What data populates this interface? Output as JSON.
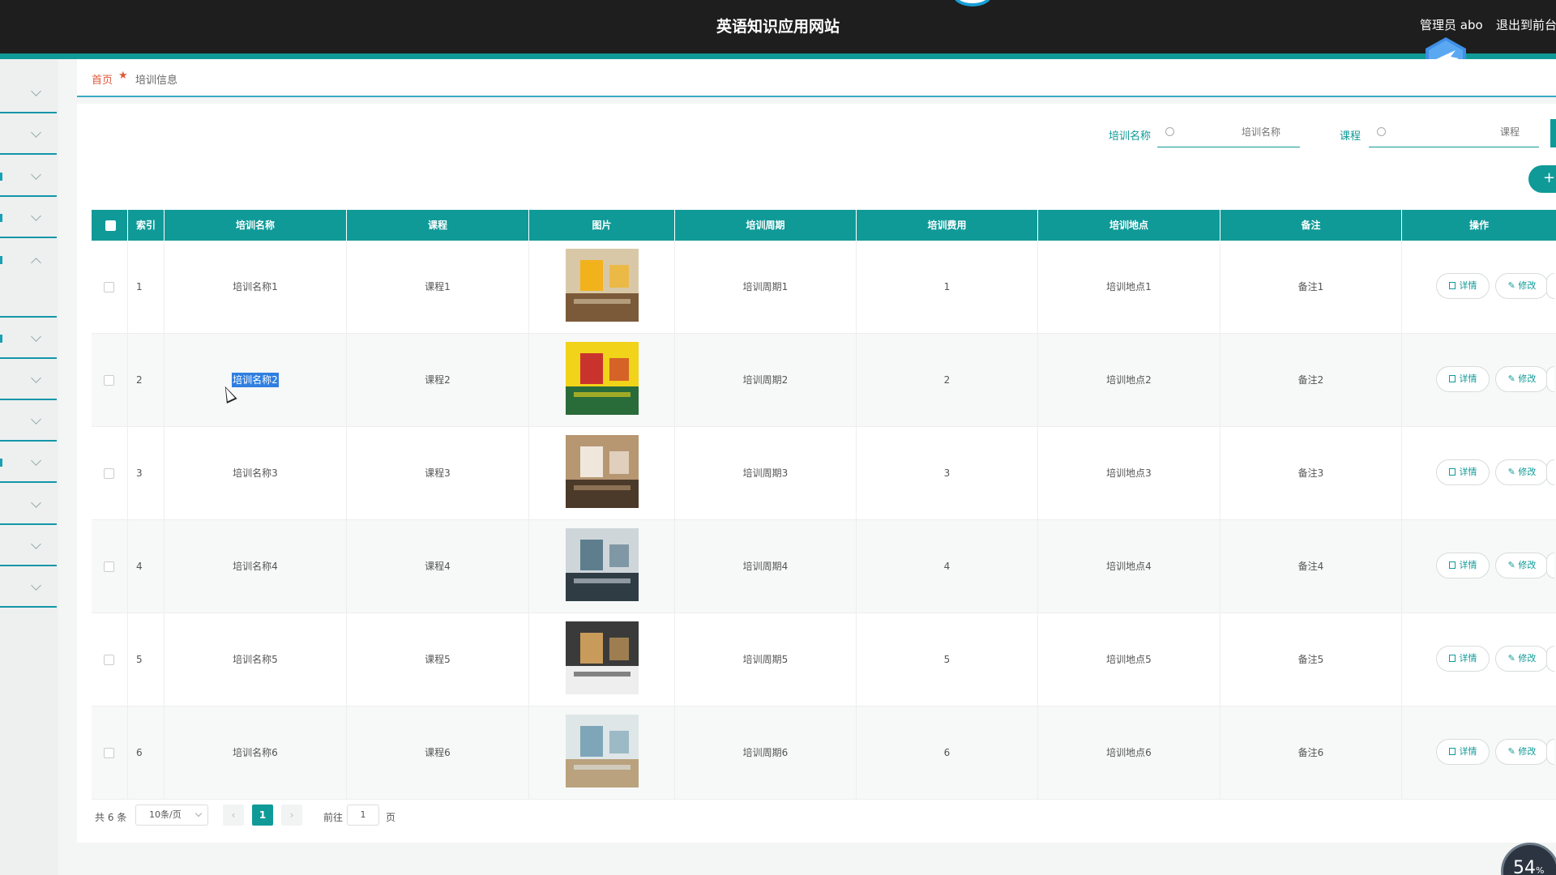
{
  "header": {
    "site_title": "英语知识应用网站",
    "user": "管理员 abo",
    "logout": "退出到前台"
  },
  "breadcrumb": {
    "home": "首页",
    "current": "培训信息"
  },
  "search": {
    "name_label": "培训名称",
    "name_placeholder": "培训名称",
    "course_label": "课程",
    "course_placeholder": "课程"
  },
  "toolbar": {
    "add_label": "+"
  },
  "table": {
    "columns": [
      "索引",
      "培训名称",
      "课程",
      "图片",
      "培训周期",
      "培训费用",
      "培训地点",
      "备注",
      "操作"
    ],
    "rows": [
      {
        "index": "1",
        "name": "培训名称1",
        "course": "课程1",
        "cycle": "培训周期1",
        "fee": "1",
        "location": "培训地点1",
        "note": "备注1"
      },
      {
        "index": "2",
        "name": "培训名称2",
        "course": "课程2",
        "cycle": "培训周期2",
        "fee": "2",
        "location": "培训地点2",
        "note": "备注2"
      },
      {
        "index": "3",
        "name": "培训名称3",
        "course": "课程3",
        "cycle": "培训周期3",
        "fee": "3",
        "location": "培训地点3",
        "note": "备注3"
      },
      {
        "index": "4",
        "name": "培训名称4",
        "course": "课程4",
        "cycle": "培训周期4",
        "fee": "4",
        "location": "培训地点4",
        "note": "备注4"
      },
      {
        "index": "5",
        "name": "培训名称5",
        "course": "课程5",
        "cycle": "培训周期5",
        "fee": "5",
        "location": "培训地点5",
        "note": "备注5"
      },
      {
        "index": "6",
        "name": "培训名称6",
        "course": "课程6",
        "cycle": "培训周期6",
        "fee": "6",
        "location": "培训地点6",
        "note": "备注6"
      }
    ],
    "detail_label": "详情",
    "edit_label": "修改"
  },
  "pagination": {
    "total": "共 6 条",
    "page_size": "10条/页",
    "prev": "‹",
    "current_page": "1",
    "next": "›",
    "goto_prefix": "前往",
    "goto_value": "1",
    "goto_suffix": "页"
  },
  "widget": {
    "value": "54",
    "suffix": "%"
  },
  "colors": {
    "primary": "#0f9a98",
    "header_bg": "#1e1e1e",
    "breadcrumb_home": "#e0573a",
    "selection": "#2f7fe0"
  }
}
